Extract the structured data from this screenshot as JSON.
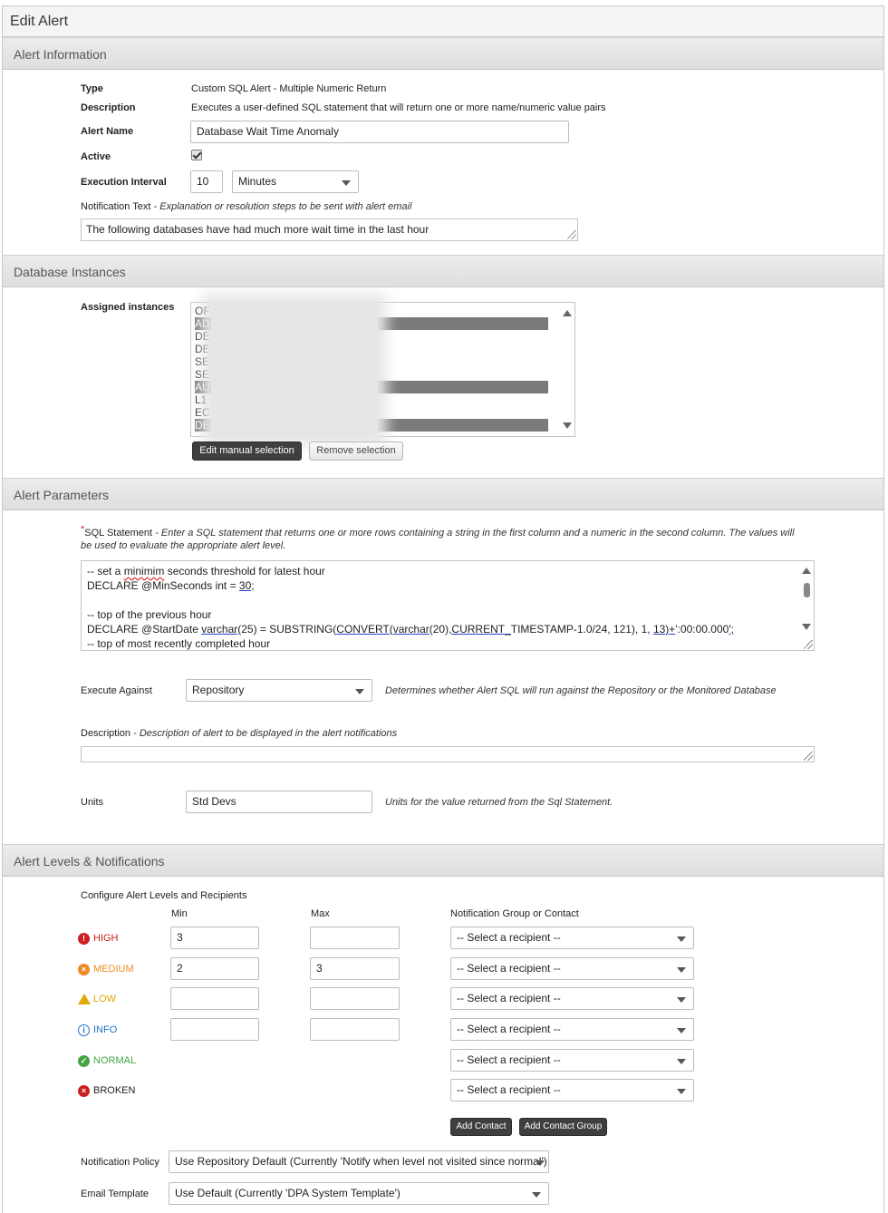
{
  "page_title": "Edit Alert",
  "sections": {
    "alert_information": "Alert Information",
    "database_instances": "Database Instances",
    "alert_parameters": "Alert Parameters",
    "alert_levels": "Alert Levels & Notifications"
  },
  "info": {
    "type_label": "Type",
    "type_value": "Custom SQL Alert - Multiple Numeric Return",
    "description_label": "Description",
    "description_value": "Executes a user-defined SQL statement that will return one or more name/numeric value pairs",
    "alert_name_label": "Alert Name",
    "alert_name_value": "Database Wait Time Anomaly",
    "active_label": "Active",
    "active_checked": true,
    "interval_label": "Execution Interval",
    "interval_value": "10",
    "interval_unit": "Minutes",
    "notification_label": "Notification Text",
    "notification_hint": "- Explanation or resolution steps to be sent with alert email",
    "notification_value": "The following databases have had much more wait time in the last hour"
  },
  "instances": {
    "label": "Assigned instances",
    "rows": [
      {
        "text": "OF",
        "selected": false
      },
      {
        "text": "AD",
        "selected": true
      },
      {
        "text": "DE",
        "selected": false
      },
      {
        "text": "DE",
        "selected": false
      },
      {
        "text": "SE",
        "selected": false
      },
      {
        "text": "SE",
        "selected": false
      },
      {
        "text": "AU",
        "selected": true
      },
      {
        "text": "L1",
        "selected": false
      },
      {
        "text": "EC",
        "selected": false
      },
      {
        "text": "DE",
        "selected": true
      }
    ],
    "edit_button": "Edit manual selection",
    "remove_button": "Remove selection"
  },
  "params": {
    "sql_required_mark": "*",
    "sql_label": "SQL Statement",
    "sql_hint": "- Enter a SQL statement that returns one or more rows containing a string in the first column and a numeric in the second column. The values will be used to evaluate the appropriate alert level.",
    "sql_lines": [
      "-- set a minimim seconds threshold for latest hour",
      "DECLARE @MinSeconds int = 30;",
      "",
      "-- top of the previous hour",
      "DECLARE @StartDate varchar(25) = SUBSTRING(CONVERT(varchar(20),CURRENT_TIMESTAMP-1.0/24, 121), 1, 13)+':00:00.000';",
      "-- top of most recently completed hour"
    ],
    "execute_label": "Execute Against",
    "execute_value": "Repository",
    "execute_hint": "Determines whether Alert SQL will run against the Repository or the Monitored Database",
    "description_label": "Description",
    "description_hint": "- Description of alert to be displayed in the alert notifications",
    "description_value": "",
    "units_label": "Units",
    "units_value": "Std Devs",
    "units_hint": "Units for the value returned from the Sql Statement."
  },
  "levels": {
    "configure_label": "Configure Alert Levels and Recipients",
    "min_header": "Min",
    "max_header": "Max",
    "recipient_header": "Notification Group or Contact",
    "rows": [
      {
        "name": "HIGH",
        "color": "#cc1f1f",
        "icon": "error-icon",
        "glyph": "!",
        "min": "3",
        "max": "",
        "has_range": true,
        "recipient": "-- Select a recipient --"
      },
      {
        "name": "MEDIUM",
        "color": "#f08a24",
        "icon": "warning-circle-icon",
        "glyph": "×",
        "min": "2",
        "max": "3",
        "has_range": true,
        "recipient": "-- Select a recipient --"
      },
      {
        "name": "LOW",
        "color": "#e0a800",
        "icon": "warning-triangle-icon",
        "glyph": "!",
        "min": "",
        "max": "",
        "has_range": true,
        "recipient": "-- Select a recipient --"
      },
      {
        "name": "INFO",
        "color": "#1f6fd1",
        "icon": "info-icon",
        "glyph": "i",
        "min": "",
        "max": "",
        "has_range": true,
        "recipient": "-- Select a recipient --"
      },
      {
        "name": "NORMAL",
        "color": "#44a544",
        "icon": "check-circle-icon",
        "glyph": "✓",
        "min": "",
        "max": "",
        "has_range": false,
        "recipient": "-- Select a recipient --"
      },
      {
        "name": "BROKEN",
        "color": "#cc1f1f",
        "icon": "broken-icon",
        "glyph": "×",
        "min": "",
        "max": "",
        "has_range": false,
        "recipient": "-- Select a recipient --"
      }
    ],
    "add_contact": "Add Contact",
    "add_contact_group": "Add Contact Group",
    "policy_label": "Notification Policy",
    "policy_value": "Use Repository Default (Currently 'Notify when level not visited since normal')",
    "template_label": "Email Template",
    "template_value": "Use Default (Currently 'DPA System Template')"
  }
}
